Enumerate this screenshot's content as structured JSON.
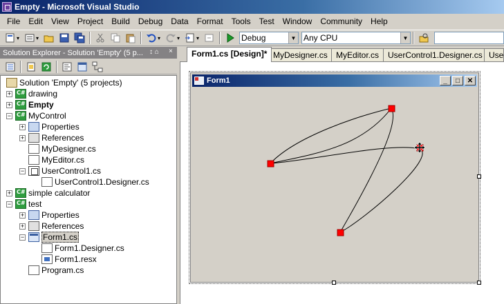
{
  "window": {
    "title": "Empty - Microsoft Visual Studio"
  },
  "menu": [
    "File",
    "Edit",
    "View",
    "Project",
    "Build",
    "Debug",
    "Data",
    "Format",
    "Tools",
    "Test",
    "Window",
    "Community",
    "Help"
  ],
  "toolbar": {
    "configuration": "Debug",
    "platform": "Any CPU"
  },
  "solution_explorer": {
    "title": "Solution Explorer - Solution 'Empty' (5 p...",
    "pin_glyph": "↕ ⌂",
    "close_glyph": "×",
    "tree": [
      {
        "label": "Solution 'Empty' (5 projects)",
        "depth": 0,
        "icon": "solution-icon",
        "expander": ""
      },
      {
        "label": "drawing",
        "depth": 1,
        "icon": "csharp-project-icon",
        "expander": "+"
      },
      {
        "label": "Empty",
        "depth": 1,
        "icon": "csharp-project-icon",
        "expander": "+",
        "bold": true
      },
      {
        "label": "MyControl",
        "depth": 1,
        "icon": "csharp-project-icon",
        "expander": "-"
      },
      {
        "label": "Properties",
        "depth": 2,
        "icon": "properties-icon",
        "expander": "+"
      },
      {
        "label": "References",
        "depth": 2,
        "icon": "references-icon",
        "expander": "+"
      },
      {
        "label": "MyDesigner.cs",
        "depth": 2,
        "icon": "cs-file-icon",
        "expander": ""
      },
      {
        "label": "MyEditor.cs",
        "depth": 2,
        "icon": "cs-file-icon",
        "expander": ""
      },
      {
        "label": "UserControl1.cs",
        "depth": 2,
        "icon": "usercontrol-icon",
        "expander": "-"
      },
      {
        "label": "UserControl1.Designer.cs",
        "depth": 3,
        "icon": "cs-file-icon",
        "expander": ""
      },
      {
        "label": "simple calculator",
        "depth": 1,
        "icon": "csharp-project-icon",
        "expander": "+"
      },
      {
        "label": "test",
        "depth": 1,
        "icon": "csharp-project-icon",
        "expander": "-"
      },
      {
        "label": "Properties",
        "depth": 2,
        "icon": "properties-icon",
        "expander": "+"
      },
      {
        "label": "References",
        "depth": 2,
        "icon": "references-icon",
        "expander": "+"
      },
      {
        "label": "Form1.cs",
        "depth": 2,
        "icon": "form-icon",
        "expander": "-",
        "selected": true
      },
      {
        "label": "Form1.Designer.cs",
        "depth": 3,
        "icon": "cs-file-icon",
        "expander": ""
      },
      {
        "label": "Form1.resx",
        "depth": 3,
        "icon": "resx-icon",
        "expander": ""
      },
      {
        "label": "Program.cs",
        "depth": 2,
        "icon": "cs-file-icon",
        "expander": ""
      }
    ]
  },
  "doc_tabs": [
    {
      "label": "Form1.cs [Design]*",
      "active": true
    },
    {
      "label": "MyDesigner.cs",
      "active": false
    },
    {
      "label": "MyEditor.cs",
      "active": false
    },
    {
      "label": "UserControl1.Designer.cs",
      "active": false
    },
    {
      "label": "User",
      "active": false
    }
  ],
  "form": {
    "caption": "Form1",
    "minimize_glyph": "_",
    "maximize_glyph": "□",
    "close_glyph": "✕",
    "control_points_color": "#ff0000"
  }
}
